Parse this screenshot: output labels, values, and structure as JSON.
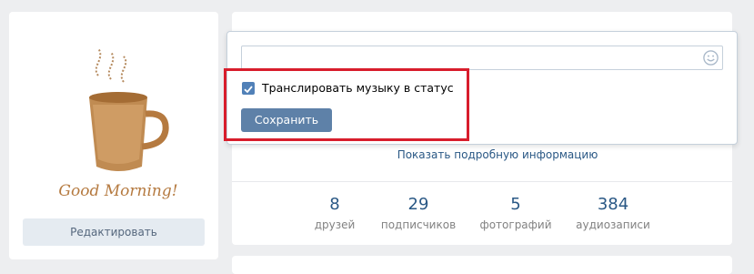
{
  "sidebar": {
    "avatar_caption": "Good Morning!",
    "edit_label": "Редактировать"
  },
  "status_editor": {
    "broadcast_label": "Транслировать музыку в статус",
    "broadcast_checked": true,
    "save_label": "Сохранить"
  },
  "profile": {
    "show_details_label": "Показать подробную информацию",
    "counters": [
      {
        "value": "8",
        "label": "друзей"
      },
      {
        "value": "29",
        "label": "подписчиков"
      },
      {
        "value": "5",
        "label": "фотографий"
      },
      {
        "value": "384",
        "label": "аудиозаписи"
      }
    ]
  },
  "colors": {
    "highlight": "#d81d2c",
    "accent": "#5181b8",
    "link": "#2a5885"
  }
}
